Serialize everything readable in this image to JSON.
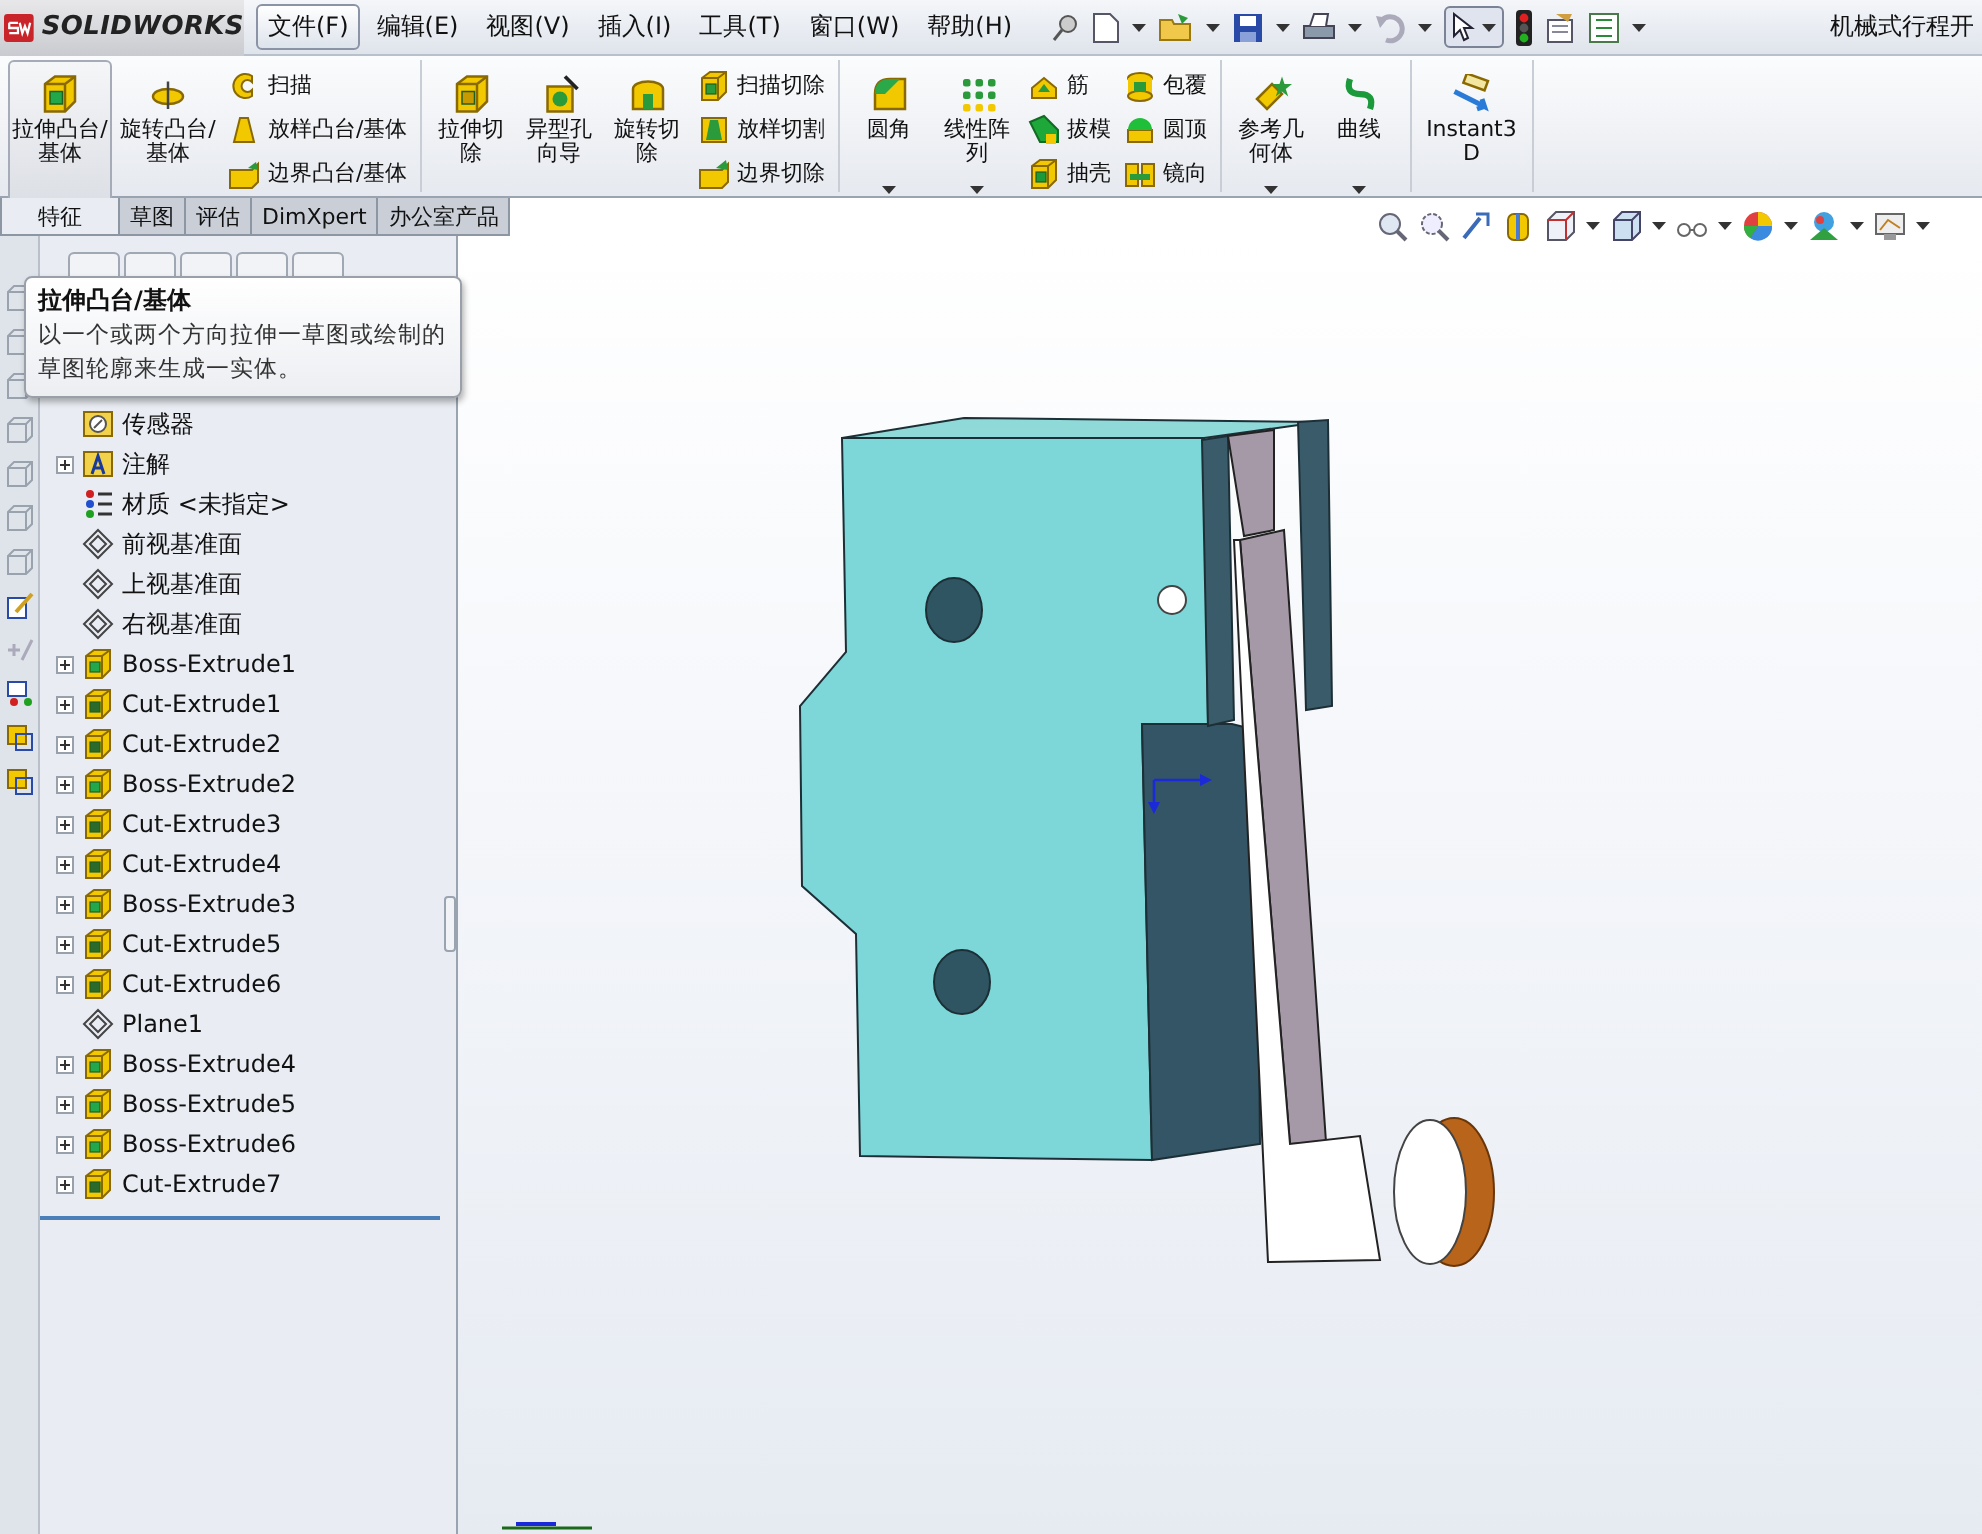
{
  "app": {
    "brand": "SOLIDWORKS"
  },
  "menu": [
    {
      "label": "文件(F)",
      "selected": true
    },
    {
      "label": "编辑(E)",
      "selected": false
    },
    {
      "label": "视图(V)",
      "selected": false
    },
    {
      "label": "插入(I)",
      "selected": false
    },
    {
      "label": "工具(T)",
      "selected": false
    },
    {
      "label": "窗口(W)",
      "selected": false
    },
    {
      "label": "帮助(H)",
      "selected": false
    }
  ],
  "document_title": "机械式行程开",
  "ribbon": {
    "groups": [
      {
        "items": [
          {
            "kind": "large",
            "label": "拉伸凸台/基体",
            "selected": true,
            "dropdown": false
          },
          {
            "kind": "large",
            "label": "旋转凸台/基体",
            "selected": false,
            "dropdown": false
          },
          {
            "kind": "stack",
            "items": [
              {
                "label": "扫描",
                "selected": false
              },
              {
                "label": "放样凸台/基体",
                "selected": false
              },
              {
                "label": "边界凸台/基体",
                "selected": false
              }
            ]
          }
        ]
      },
      {
        "items": [
          {
            "kind": "large",
            "label": "拉伸切除",
            "selected": false,
            "dropdown": false
          },
          {
            "kind": "large",
            "label": "异型孔向导",
            "selected": false,
            "dropdown": false
          },
          {
            "kind": "large",
            "label": "旋转切除",
            "selected": false,
            "dropdown": false
          },
          {
            "kind": "stack",
            "items": [
              {
                "label": "扫描切除",
                "selected": false
              },
              {
                "label": "放样切割",
                "selected": false
              },
              {
                "label": "边界切除",
                "selected": false
              }
            ]
          }
        ]
      },
      {
        "items": [
          {
            "kind": "large",
            "label": "圆角",
            "selected": false,
            "dropdown": true
          },
          {
            "kind": "large",
            "label": "线性阵列",
            "selected": false,
            "dropdown": true
          },
          {
            "kind": "stack",
            "items": [
              {
                "label": "筋",
                "selected": false
              },
              {
                "label": "拔模",
                "selected": false
              },
              {
                "label": "抽壳",
                "selected": false
              }
            ]
          },
          {
            "kind": "stack",
            "items": [
              {
                "label": "包覆",
                "selected": false
              },
              {
                "label": "圆顶",
                "selected": false
              },
              {
                "label": "镜向",
                "selected": false
              }
            ]
          }
        ]
      },
      {
        "items": [
          {
            "kind": "large",
            "label": "参考几何体",
            "selected": false,
            "dropdown": true
          },
          {
            "kind": "large",
            "label": "曲线",
            "selected": false,
            "dropdown": true
          }
        ]
      },
      {
        "items": [
          {
            "kind": "large",
            "label": "Instant3D",
            "selected": false,
            "dropdown": false
          }
        ]
      }
    ]
  },
  "tabs": [
    {
      "label": "特征",
      "selected": true
    },
    {
      "label": "草图",
      "selected": false
    },
    {
      "label": "评估",
      "selected": false
    },
    {
      "label": "DimXpert",
      "selected": false
    },
    {
      "label": "办公室产品",
      "selected": false
    }
  ],
  "tooltip": {
    "title": "拉伸凸台/基体",
    "text": "以一个或两个方向拉伸一草图或绘制的草图轮廓来生成一实体。"
  },
  "feature_tree": [
    {
      "kind": "sensor",
      "label": "传感器",
      "expandable": false
    },
    {
      "kind": "annotation",
      "label": "注解",
      "expandable": true
    },
    {
      "kind": "material",
      "label": "材质 <未指定>",
      "expandable": false
    },
    {
      "kind": "plane",
      "label": "前视基准面",
      "expandable": false
    },
    {
      "kind": "plane",
      "label": "上视基准面",
      "expandable": false
    },
    {
      "kind": "plane",
      "label": "右视基准面",
      "expandable": false
    },
    {
      "kind": "boss",
      "label": "Boss-Extrude1",
      "expandable": true
    },
    {
      "kind": "cut",
      "label": "Cut-Extrude1",
      "expandable": true
    },
    {
      "kind": "cut",
      "label": "Cut-Extrude2",
      "expandable": true
    },
    {
      "kind": "boss",
      "label": "Boss-Extrude2",
      "expandable": true
    },
    {
      "kind": "cut",
      "label": "Cut-Extrude3",
      "expandable": true
    },
    {
      "kind": "cut",
      "label": "Cut-Extrude4",
      "expandable": true
    },
    {
      "kind": "boss",
      "label": "Boss-Extrude3",
      "expandable": true
    },
    {
      "kind": "cut",
      "label": "Cut-Extrude5",
      "expandable": true
    },
    {
      "kind": "cut",
      "label": "Cut-Extrude6",
      "expandable": true
    },
    {
      "kind": "plane",
      "label": "Plane1",
      "expandable": false
    },
    {
      "kind": "boss",
      "label": "Boss-Extrude4",
      "expandable": true
    },
    {
      "kind": "boss",
      "label": "Boss-Extrude5",
      "expandable": true
    },
    {
      "kind": "boss",
      "label": "Boss-Extrude6",
      "expandable": true
    },
    {
      "kind": "cut",
      "label": "Cut-Extrude7",
      "expandable": true
    }
  ]
}
